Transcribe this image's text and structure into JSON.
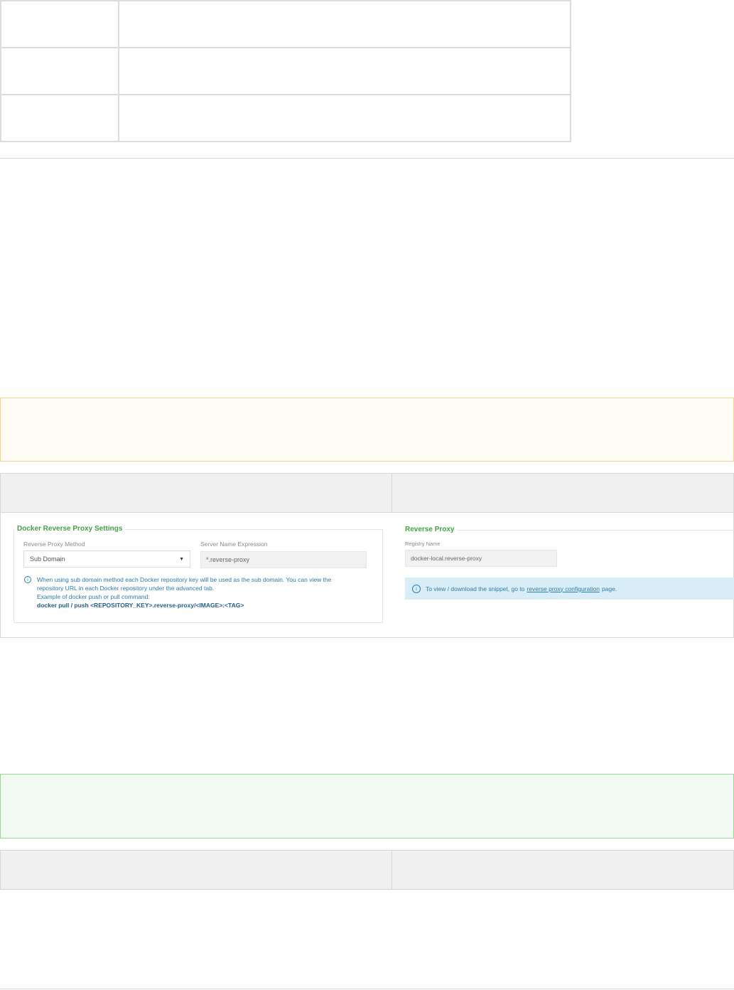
{
  "docker_settings": {
    "legend": "Docker Reverse Proxy Settings",
    "method_label": "Reverse Proxy Method",
    "method_value": "Sub Domain",
    "server_label": "Server Name Expression",
    "server_value": "*.reverse-proxy",
    "info_line1": "When using sub domain method each Docker repository key will be used as the sub domain. You can view the",
    "info_line2": "repository URL in each Docker repository under the advanced tab.",
    "info_line3": "Example of docker push or pull command:",
    "info_command": "docker pull / push <REPOSITORY_KEY>.reverse-proxy/<IMAGE>:<TAG>"
  },
  "reverse_proxy": {
    "legend": "Reverse Proxy",
    "registry_label": "Registry Name",
    "registry_value": "docker-local.reverse-proxy",
    "info_prefix": "To view / download the snippet, go to",
    "info_link": "reverse proxy configuration",
    "info_suffix": "page."
  },
  "colors": {
    "legend_green": "#43a047",
    "info_blue": "#2b7ca8",
    "warning_border": "#f7d68a",
    "success_border": "#96d796"
  },
  "icons": {
    "dropdown": "caret-down-icon",
    "info": "info-circle-icon"
  }
}
